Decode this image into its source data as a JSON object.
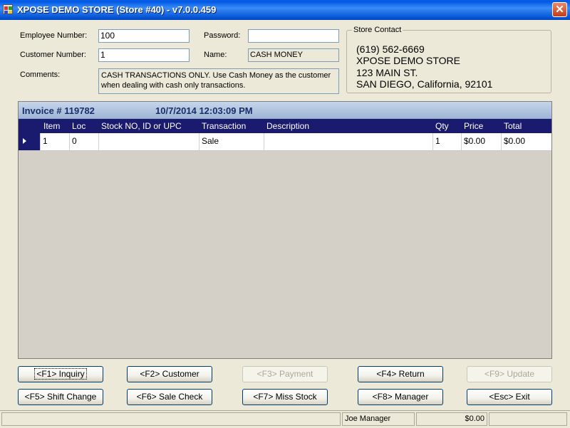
{
  "window": {
    "title": "XPOSE DEMO STORE (Store #40) - v7.0.0.459",
    "close_glyph": "✕",
    "icon": "app-window-icon"
  },
  "form": {
    "employee_number_label": "Employee Number:",
    "employee_number_value": "100",
    "customer_number_label": "Customer Number:",
    "customer_number_value": "1",
    "password_label": "Password:",
    "password_value": "",
    "name_label": "Name:",
    "name_value": "CASH MONEY",
    "comments_label": "Comments:",
    "comments_value": "CASH TRANSACTIONS ONLY. Use Cash Money as the customer when dealing with cash only transactions."
  },
  "store_contact": {
    "title": "Store Contact",
    "phone": "(619) 562-6669",
    "name": "XPOSE DEMO STORE",
    "address": "123 MAIN ST.",
    "city_state_zip": "SAN DIEGO, California, 92101"
  },
  "invoice": {
    "number": "Invoice # 119782",
    "datetime": "10/7/2014 12:03:09 PM",
    "columns": [
      "Item",
      "Loc",
      "Stock NO, ID or UPC",
      "Transaction",
      "Description",
      "Qty",
      "Price",
      "Total"
    ],
    "rows": [
      {
        "item": "1",
        "loc": "0",
        "stock": "",
        "transaction": "Sale",
        "description": "",
        "qty": "1",
        "price": "$0.00",
        "total": "$0.00"
      }
    ]
  },
  "buttons": {
    "f1": "<F1> Inquiry",
    "f2": "<F2> Customer",
    "f3": "<F3> Payment",
    "f4": "<F4> Return",
    "f9": "<F9> Update",
    "f5": "<F5> Shift Change",
    "f6": "<F6> Sale Check",
    "f7": "<F7> Miss Stock",
    "f8": "<F8> Manager",
    "esc": "<Esc> Exit"
  },
  "status": {
    "user": "Joe Manager",
    "amount": "$0.00"
  },
  "colors": {
    "title_bar": "#0058e6",
    "grid_header": "#1a1a6e",
    "invoice_header": "#9fb6d6",
    "window_bg": "#ece9d8"
  }
}
